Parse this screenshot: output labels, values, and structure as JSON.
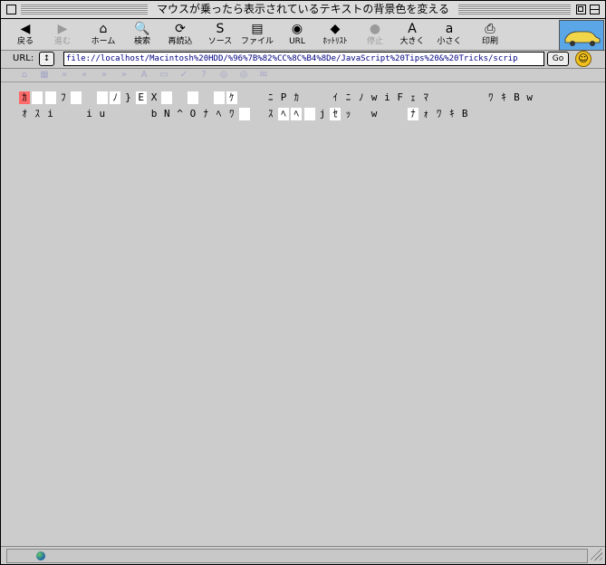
{
  "window": {
    "title": "マウスが乗ったら表示されているテキストの背景色を変える"
  },
  "toolbar": {
    "buttons": [
      {
        "label": "戻る",
        "icon": "back-arrow-icon",
        "glyph": "◀",
        "disabled": false
      },
      {
        "label": "進む",
        "icon": "forward-arrow-icon",
        "glyph": "▶",
        "disabled": true
      },
      {
        "label": "ホーム",
        "icon": "home-icon",
        "glyph": "⌂",
        "disabled": false
      },
      {
        "label": "検索",
        "icon": "search-icon",
        "glyph": "🔍",
        "disabled": false
      },
      {
        "label": "再読込",
        "icon": "reload-icon",
        "glyph": "⟳",
        "disabled": false
      },
      {
        "label": "ソース",
        "icon": "source-icon",
        "glyph": "S",
        "disabled": false
      },
      {
        "label": "ファイル",
        "icon": "file-icon",
        "glyph": "▤",
        "disabled": false
      },
      {
        "label": "URL",
        "icon": "url-globe-icon",
        "glyph": "◉",
        "disabled": false
      },
      {
        "label": "ﾎｯﾄﾘｽﾄ",
        "icon": "hotlist-icon",
        "glyph": "◆",
        "disabled": false
      },
      {
        "label": "停止",
        "icon": "stop-icon",
        "glyph": "●",
        "disabled": true
      },
      {
        "label": "大きく",
        "icon": "bigger-text-icon",
        "glyph": "A",
        "disabled": false
      },
      {
        "label": "小さく",
        "icon": "smaller-text-icon",
        "glyph": "a",
        "disabled": false
      },
      {
        "label": "印刷",
        "icon": "print-icon",
        "glyph": "⎙",
        "disabled": false
      }
    ]
  },
  "urlbar": {
    "label": "URL:",
    "popup_glyph": "↕",
    "value": "file://localhost/Macintosh%20HDD/%96%7B%82%CC%8C%B4%8De/JavaScript%20Tips%20&%20Tricks/scrip",
    "go_label": "Go",
    "smiley_glyph": "☺"
  },
  "subbar": {
    "icons": [
      "⌂",
      "▦",
      "«",
      "«",
      "»",
      "»",
      "A",
      "▭",
      "✓",
      "?",
      "◎",
      "◎",
      "✉"
    ]
  },
  "content": {
    "rows": [
      {
        "chars": [
          {
            "c": "ｶ",
            "hl": "red"
          },
          {
            "c": "",
            "hl": "white"
          },
          {
            "c": "",
            "hl": "white"
          },
          {
            "c": "ﾌ",
            "hl": ""
          },
          {
            "c": "",
            "hl": "white"
          },
          {
            "c": "",
            "hl": ""
          },
          {
            "c": "",
            "hl": "white"
          },
          {
            "c": "ﾉ",
            "hl": "white"
          },
          {
            "c": "}",
            "hl": ""
          },
          {
            "c": "E",
            "hl": "white"
          },
          {
            "c": "X",
            "hl": ""
          },
          {
            "c": "",
            "hl": "white"
          },
          {
            "c": "",
            "hl": ""
          },
          {
            "c": "",
            "hl": "white"
          },
          {
            "c": "",
            "hl": ""
          },
          {
            "c": "",
            "hl": "white"
          },
          {
            "c": "ｹ",
            "hl": "white"
          },
          {
            "c": "",
            "hl": ""
          },
          {
            "c": "",
            "hl": ""
          },
          {
            "c": "ﾆ",
            "hl": ""
          },
          {
            "c": "P",
            "hl": ""
          },
          {
            "c": "ｶ",
            "hl": ""
          },
          {
            "c": "",
            "hl": ""
          },
          {
            "c": "",
            "hl": ""
          },
          {
            "c": "ｲ",
            "hl": ""
          },
          {
            "c": "ﾆ",
            "hl": ""
          },
          {
            "c": "ﾉ",
            "hl": ""
          },
          {
            "c": "w",
            "hl": ""
          },
          {
            "c": "i",
            "hl": ""
          },
          {
            "c": "F",
            "hl": ""
          },
          {
            "c": "ｪ",
            "hl": ""
          },
          {
            "c": "ﾏ",
            "hl": ""
          },
          {
            "c": "",
            "hl": ""
          },
          {
            "c": "",
            "hl": ""
          },
          {
            "c": "",
            "hl": ""
          },
          {
            "c": "",
            "hl": ""
          },
          {
            "c": "ﾜ",
            "hl": ""
          },
          {
            "c": "ｷ",
            "hl": ""
          },
          {
            "c": "B",
            "hl": ""
          },
          {
            "c": "w",
            "hl": ""
          }
        ]
      },
      {
        "chars": [
          {
            "c": "ｵ",
            "hl": ""
          },
          {
            "c": "ｽ",
            "hl": ""
          },
          {
            "c": "i",
            "hl": ""
          },
          {
            "c": "",
            "hl": ""
          },
          {
            "c": "",
            "hl": ""
          },
          {
            "c": "i",
            "hl": ""
          },
          {
            "c": "u",
            "hl": ""
          },
          {
            "c": "",
            "hl": ""
          },
          {
            "c": "",
            "hl": ""
          },
          {
            "c": "",
            "hl": ""
          },
          {
            "c": "b",
            "hl": ""
          },
          {
            "c": "N",
            "hl": ""
          },
          {
            "c": "^",
            "hl": ""
          },
          {
            "c": "O",
            "hl": ""
          },
          {
            "c": "ﾅ",
            "hl": ""
          },
          {
            "c": "ﾍ",
            "hl": ""
          },
          {
            "c": "ﾜ",
            "hl": ""
          },
          {
            "c": "",
            "hl": "white"
          },
          {
            "c": "",
            "hl": ""
          },
          {
            "c": "ｽ",
            "hl": ""
          },
          {
            "c": "ﾍ",
            "hl": "white"
          },
          {
            "c": "ﾍ",
            "hl": "white"
          },
          {
            "c": "",
            "hl": "white"
          },
          {
            "c": "j",
            "hl": ""
          },
          {
            "c": "ｾ",
            "hl": "white"
          },
          {
            "c": "ｯ",
            "hl": ""
          },
          {
            "c": "",
            "hl": ""
          },
          {
            "c": "w",
            "hl": ""
          },
          {
            "c": "",
            "hl": ""
          },
          {
            "c": "",
            "hl": ""
          },
          {
            "c": "ﾅ",
            "hl": "white"
          },
          {
            "c": "ｫ",
            "hl": ""
          },
          {
            "c": "ﾜ",
            "hl": ""
          },
          {
            "c": "ｷ",
            "hl": ""
          },
          {
            "c": "B",
            "hl": ""
          }
        ]
      }
    ]
  },
  "colors": {
    "highlight": "#ffffff",
    "active_highlight": "#ff6a6a",
    "background": "#cccccc"
  }
}
